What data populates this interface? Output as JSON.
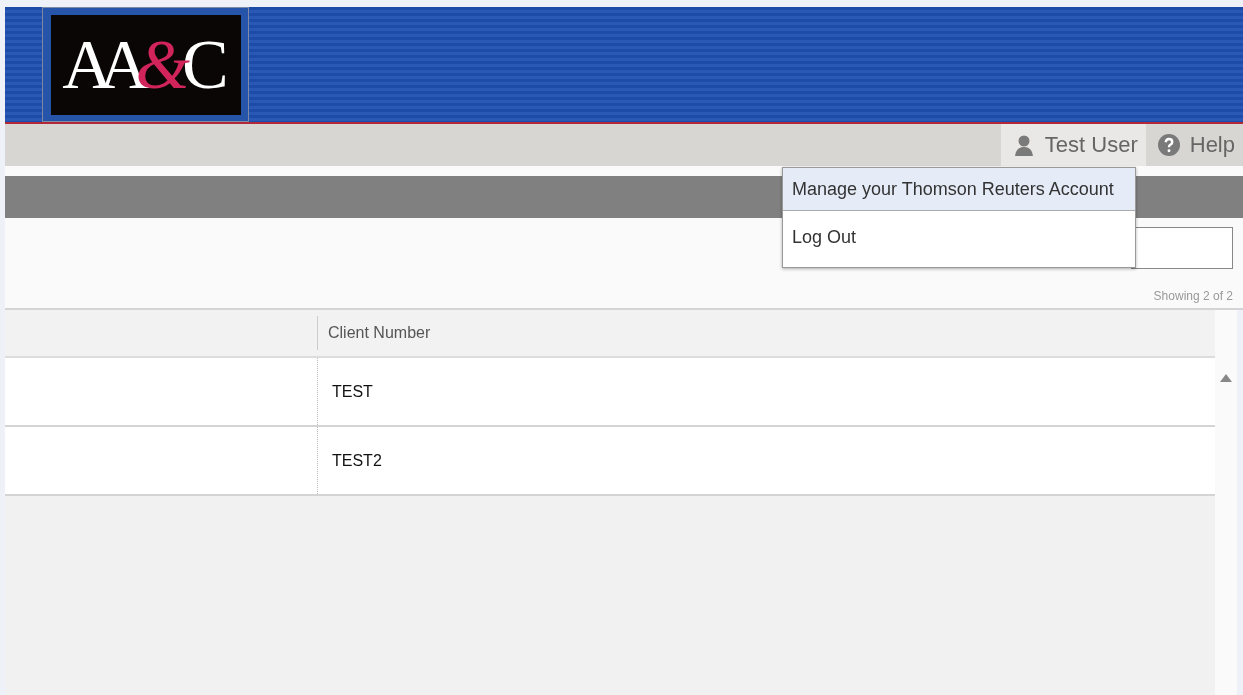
{
  "logo": {
    "letters": [
      {
        "text": "AA",
        "color": "#ffffff"
      },
      {
        "text": "&",
        "color": "#d0245a"
      },
      {
        "text": "C",
        "color": "#ffffff"
      }
    ]
  },
  "user_bar": {
    "user": "Test User",
    "help": "Help"
  },
  "user_menu": {
    "expanded": true,
    "items": [
      {
        "label": "Manage your Thomson Reuters Account",
        "selected": true
      },
      {
        "label": "Log Out",
        "selected": false
      }
    ]
  },
  "table": {
    "count": "Showing 2 of 2",
    "columns": [
      "",
      "Client Number"
    ],
    "rows": [
      {
        "cells": [
          "",
          "TEST"
        ]
      },
      {
        "cells": [
          "",
          "TEST2"
        ]
      }
    ]
  }
}
